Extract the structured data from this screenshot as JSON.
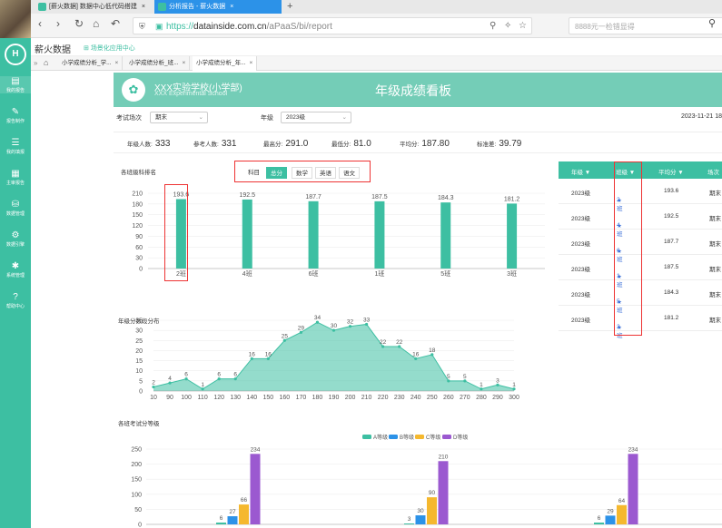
{
  "browser": {
    "tabs": [
      {
        "label": "[薪火数据] 数据中心低代码搭建"
      },
      {
        "label": "分析报告 - 薪火数据"
      }
    ],
    "close_glyph": "×",
    "new_tab": "+",
    "url_prefix": "https://",
    "url_host": "datainside.com.cn",
    "url_path": "/aPaaS/bi/report",
    "search_placeholder": "8888元一检错显得"
  },
  "app": {
    "title": "薪火数据",
    "link": "场景化应用中心",
    "logo_text": "H"
  },
  "sidebar": {
    "items": [
      {
        "label": "我的报告",
        "icon": "report-icon",
        "glyph": "▤"
      },
      {
        "label": "报告制作",
        "icon": "edit-icon",
        "glyph": "✎"
      },
      {
        "label": "我的填报",
        "icon": "form-icon",
        "glyph": "☰"
      },
      {
        "label": "主审报告",
        "icon": "review-icon",
        "glyph": "▦"
      },
      {
        "label": "数据管理",
        "icon": "database-icon",
        "glyph": "⛁"
      },
      {
        "label": "数据引擎",
        "icon": "engine-icon",
        "glyph": "⚙"
      },
      {
        "label": "系统管理",
        "icon": "settings-icon",
        "glyph": "✱"
      },
      {
        "label": "帮助中心",
        "icon": "help-icon",
        "glyph": "?"
      }
    ]
  },
  "page_tabs": [
    {
      "label": "小学成绩分析_学..."
    },
    {
      "label": "小学成绩分析_班..."
    },
    {
      "label": "小学成绩分析_年..."
    }
  ],
  "banner": {
    "school": "XXX实验学校(小学部)",
    "school_en": "XXX Experimental School",
    "title": "年级成绩看板"
  },
  "filters": {
    "exam_label": "考试场次",
    "exam_value": "期末",
    "grade_label": "年级",
    "grade_value": "2023级",
    "datetime": "2023-11-21 18"
  },
  "stats": [
    {
      "label": "年级人数:",
      "value": "333"
    },
    {
      "label": "参考人数:",
      "value": "331"
    },
    {
      "label": "最高分:",
      "value": "291.0"
    },
    {
      "label": "最低分:",
      "value": "81.0"
    },
    {
      "label": "平均分:",
      "value": "187.80"
    },
    {
      "label": "标准差:",
      "value": "39.79"
    }
  ],
  "subjects": {
    "items": [
      "科目",
      "总分",
      "数学",
      "英语",
      "语文"
    ],
    "selected": "总分"
  },
  "chart1_title": "各班級科排名",
  "chart2_title": "年级分数段分布",
  "chart3_title": "各班考试分等级",
  "ranking_table": {
    "headers": [
      "年级 ▼",
      "班级 ▼",
      "平均分 ▼",
      "场次"
    ],
    "rows": [
      {
        "grade": "2023级",
        "class": "2班",
        "avg": "193.6",
        "exam": "期末"
      },
      {
        "grade": "2023级",
        "class": "4班",
        "avg": "192.5",
        "exam": "期末"
      },
      {
        "grade": "2023级",
        "class": "6班",
        "avg": "187.7",
        "exam": "期末"
      },
      {
        "grade": "2023级",
        "class": "1班",
        "avg": "187.5",
        "exam": "期末"
      },
      {
        "grade": "2023级",
        "class": "5班",
        "avg": "184.3",
        "exam": "期末"
      },
      {
        "grade": "2023级",
        "class": "3班",
        "avg": "181.2",
        "exam": "期末"
      }
    ]
  },
  "chart_data": [
    {
      "type": "bar",
      "categories": [
        "2班",
        "4班",
        "6班",
        "1班",
        "5班",
        "3班"
      ],
      "values": [
        193.6,
        192.5,
        187.7,
        187.5,
        184.3,
        181.2
      ],
      "ylim": [
        0,
        210
      ],
      "yticks": [
        0,
        30,
        60,
        90,
        120,
        150,
        180,
        210
      ],
      "color": "#3dbfa2",
      "grid": true
    },
    {
      "type": "area",
      "x": [
        10,
        90,
        100,
        110,
        120,
        130,
        140,
        150,
        160,
        170,
        180,
        190,
        200,
        210,
        220,
        230,
        240,
        250,
        260,
        270,
        280,
        290,
        300
      ],
      "values": [
        2,
        4,
        6,
        1,
        6,
        6,
        16,
        16,
        25,
        29,
        34,
        30,
        32,
        33,
        22,
        22,
        16,
        18,
        5,
        5,
        1,
        3,
        1
      ],
      "ylim": [
        0,
        35
      ],
      "yticks": [
        0,
        5,
        10,
        15,
        20,
        25,
        30,
        35
      ],
      "color": "#3dbfa2",
      "grid": true
    },
    {
      "type": "bar",
      "legend": [
        "A等级",
        "B等级",
        "C等级",
        "D等级"
      ],
      "legend_position": "top",
      "colors": [
        "#3dbfa2",
        "#2c92e8",
        "#f5b82e",
        "#9b59d0"
      ],
      "groups": [
        {
          "values": [
            6,
            27,
            66,
            234
          ]
        },
        {
          "values": [
            3,
            30,
            90,
            210
          ]
        },
        {
          "values": [
            6,
            29,
            64,
            234
          ]
        }
      ],
      "ylim": [
        0,
        250
      ],
      "yticks": [
        0,
        50,
        100,
        150,
        200,
        250
      ],
      "grid": true
    }
  ]
}
